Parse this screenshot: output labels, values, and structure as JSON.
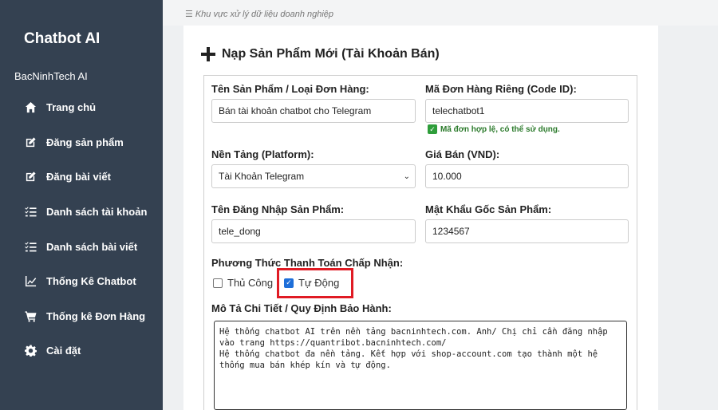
{
  "sidebar": {
    "brand": "Chatbot AI",
    "site": "BacNinhTech AI",
    "items": [
      {
        "label": "Trang chủ",
        "icon": "home-icon"
      },
      {
        "label": "Đăng sản phẩm",
        "icon": "edit-icon"
      },
      {
        "label": "Đăng bài viết",
        "icon": "edit-icon"
      },
      {
        "label": "Danh sách tài khoản",
        "icon": "list-icon"
      },
      {
        "label": "Danh sách bài viết",
        "icon": "list-icon"
      },
      {
        "label": "Thống Kê Chatbot",
        "icon": "chart-icon"
      },
      {
        "label": "Thống kê Đơn Hàng",
        "icon": "cart-icon"
      },
      {
        "label": "Cài đặt",
        "icon": "gear-icon"
      }
    ]
  },
  "topbar": {
    "breadcrumb": "☰ Khu vực xử lý dữ liệu doanh nghiệp"
  },
  "form": {
    "title": "Nạp Sản Phẩm Mới (Tài Khoản Bán)",
    "product_name_label": "Tên Sản Phẩm / Loại Đơn Hàng:",
    "product_name_value": "Bán tài khoản chatbot cho Telegram",
    "order_code_label": "Mã Đơn Hàng Riêng (Code ID):",
    "order_code_value": "telechatbot1",
    "order_code_note": "Mã đơn hợp lệ, có thể sử dụng.",
    "platform_label": "Nền Tảng (Platform):",
    "platform_value": "Tài Khoản Telegram",
    "price_label": "Giá Bán (VND):",
    "price_value": "10.000",
    "username_label": "Tên Đăng Nhập Sản Phẩm:",
    "username_value": "tele_dong",
    "password_label": "Mật Khẩu Gốc Sản Phẩm:",
    "password_value": "1234567",
    "payment_label": "Phương Thức Thanh Toán Chấp Nhận:",
    "payment_manual_label": "Thủ Công",
    "payment_auto_label": "Tự Động",
    "description_label": "Mô Tả Chi Tiết / Quy Định Bảo Hành:",
    "description_value": "Hệ thống chatbot AI trên nền tảng bacninhtech.com. Anh/ Chị chỉ cần đăng nhập vào trang https://quantribot.bacninhtech.com/\nHệ thống chatbot đa nền tảng. Kết hợp với shop-account.com tạo thành một hệ thống mua bán khép kín và tự động."
  },
  "colors": {
    "sidebar_bg": "#344151",
    "highlight": "#e01b24",
    "ok_green": "#2e9d3a",
    "check_blue": "#1e6fd9"
  }
}
